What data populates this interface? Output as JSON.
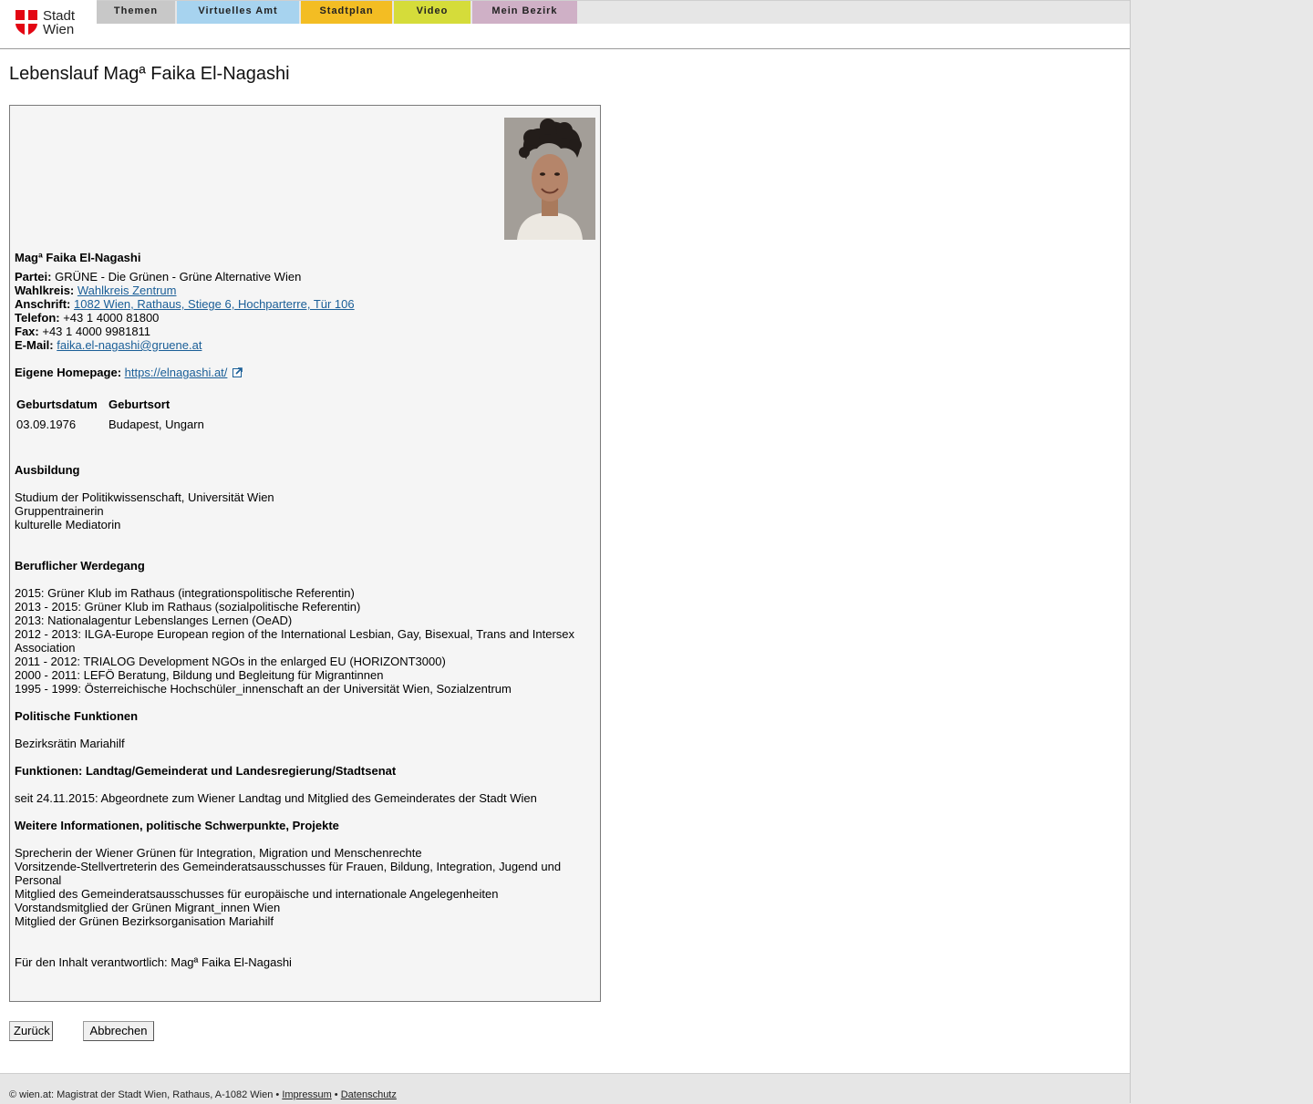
{
  "header": {
    "logo_line1": "Stadt",
    "logo_line2": "Wien",
    "nav": [
      {
        "label": "Themen",
        "color": "#c8c8c8"
      },
      {
        "label": "Virtuelles Amt",
        "color": "#a7d3ef"
      },
      {
        "label": "Stadtplan",
        "color": "#f3bd23"
      },
      {
        "label": "Video",
        "color": "#d5dc3a"
      },
      {
        "label": "Mein Bezirk",
        "color": "#cfb0c6"
      }
    ]
  },
  "page_title": "Lebenslauf Magª Faika El-Nagashi",
  "profile": {
    "name": "Magª Faika El-Nagashi",
    "partei_label": "Partei:",
    "partei_value": "GRÜNE - Die Grünen - Grüne Alternative Wien",
    "wahlkreis_label": "Wahlkreis:",
    "wahlkreis_value": "Wahlkreis Zentrum",
    "anschrift_label": "Anschrift:",
    "anschrift_value": "1082 Wien, Rathaus, Stiege 6, Hochparterre, Tür 106",
    "telefon_label": "Telefon:",
    "telefon_value": "+43 1 4000 81800",
    "fax_label": "Fax:",
    "fax_value": "+43 1 4000 9981811",
    "email_label": "E-Mail:",
    "email_value": "faika.el-nagashi@gruene.at",
    "homepage_label": "Eigene Homepage:",
    "homepage_value": "https://elnagashi.at/",
    "birth_table": {
      "headers": [
        "Geburtsdatum",
        "Geburtsort"
      ],
      "values": [
        "03.09.1976",
        "Budapest, Ungarn"
      ]
    },
    "ausbildung_heading": "Ausbildung",
    "ausbildung": [
      "Studium der Politikwissenschaft, Universität Wien",
      "Gruppentrainerin",
      "kulturelle Mediatorin"
    ],
    "werdegang_heading": "Beruflicher Werdegang",
    "werdegang": [
      "2015: Grüner Klub im Rathaus (integrationspolitische Referentin)",
      "2013 - 2015: Grüner Klub im Rathaus (sozialpolitische Referentin)",
      "2013: Nationalagentur Lebenslanges Lernen (OeAD)",
      "2012 - 2013: ILGA-Europe European region of the International Lesbian, Gay, Bisexual, Trans and Intersex Association",
      "2011 - 2012: TRIALOG Development NGOs in the enlarged EU (HORIZONT3000)",
      "2000 - 2011: LEFÖ Beratung, Bildung und Begleitung für Migrantinnen",
      "1995 - 1999: Österreichische Hochschüler_innenschaft an der Universität Wien, Sozialzentrum"
    ],
    "politische_heading": "Politische Funktionen",
    "politische": "Bezirksrätin Mariahilf",
    "funktionen_heading": "Funktionen: Landtag/Gemeinderat und Landesregierung/Stadtsenat",
    "funktionen": "seit 24.11.2015: Abgeordnete zum Wiener Landtag und Mitglied des Gemeinderates der Stadt Wien",
    "weitere_heading": "Weitere Informationen, politische Schwerpunkte, Projekte",
    "weitere": [
      "Sprecherin der Wiener Grünen für Integration, Migration und Menschenrechte",
      "Vorsitzende-Stellvertreterin des Gemeinderatsausschusses für Frauen, Bildung, Integration, Jugend und Personal",
      "Mitglied des Gemeinderatsausschusses für europäische und internationale Angelegenheiten",
      "Vorstandsmitglied der Grünen Migrant_innen Wien",
      "Mitglied der Grünen Bezirksorganisation Mariahilf"
    ],
    "verantwortlich": "Für den Inhalt verantwortlich: Magª Faika El-Nagashi"
  },
  "buttons": {
    "back": "Zurück",
    "cancel": "Abbrechen"
  },
  "footer": {
    "copyright": "© wien.at: Magistrat der Stadt Wien, Rathaus, A-1082 Wien •",
    "impressum": "Impressum",
    "separator": "•",
    "datenschutz": "Datenschutz"
  },
  "colors": {
    "link": "#1a5e97",
    "logo_red": "#e30613"
  }
}
